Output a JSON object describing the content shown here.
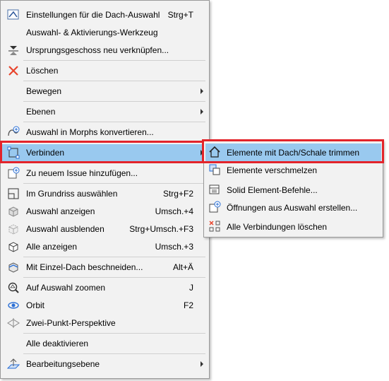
{
  "menu": {
    "items": [
      {
        "label": "Einstellungen für die Dach-Auswahl",
        "shortcut": "Strg+T",
        "icon": "roof-settings-icon"
      },
      {
        "label": "Auswahl- & Aktivierungs-Werkzeug",
        "shortcut": "",
        "icon": ""
      },
      {
        "label": "Ursprungsgeschoss neu verknüpfen...",
        "shortcut": "",
        "icon": "story-link-icon"
      },
      {
        "label": "Löschen",
        "shortcut": "",
        "icon": "delete-x-icon"
      },
      {
        "label": "Bewegen",
        "shortcut": "",
        "icon": "",
        "submenu": true
      },
      {
        "label": "Ebenen",
        "shortcut": "",
        "icon": "",
        "submenu": true
      },
      {
        "label": "Auswahl in Morphs konvertieren...",
        "shortcut": "",
        "icon": "morph-convert-icon"
      },
      {
        "label": "Verbinden",
        "shortcut": "",
        "icon": "connect-icon",
        "submenu": true
      },
      {
        "label": "Zu neuem Issue hinzufügen...",
        "shortcut": "",
        "icon": "issue-add-icon"
      },
      {
        "label": "Im Grundriss auswählen",
        "shortcut": "Strg+F2",
        "icon": "floorplan-select-icon"
      },
      {
        "label": "Auswahl anzeigen",
        "shortcut": "Umsch.+4",
        "icon": "show-selection-icon"
      },
      {
        "label": "Auswahl ausblenden",
        "shortcut": "Strg+Umsch.+F3",
        "icon": "hide-selection-icon"
      },
      {
        "label": "Alle anzeigen",
        "shortcut": "Umsch.+3",
        "icon": "show-all-icon"
      },
      {
        "label": "Mit Einzel-Dach beschneiden...",
        "shortcut": "Alt+Ä",
        "icon": "trim-roof-icon"
      },
      {
        "label": "Auf Auswahl zoomen",
        "shortcut": "J",
        "icon": "zoom-selection-icon"
      },
      {
        "label": "Orbit",
        "shortcut": "F2",
        "icon": "orbit-icon"
      },
      {
        "label": "Zwei-Punkt-Perspektive",
        "shortcut": "",
        "icon": "two-point-perspective-icon"
      },
      {
        "label": "Alle deaktivieren",
        "shortcut": "",
        "icon": ""
      },
      {
        "label": "Bearbeitungsebene",
        "shortcut": "",
        "icon": "editing-plane-icon",
        "submenu": true
      }
    ]
  },
  "submenu": {
    "items": [
      {
        "label": "Elemente mit Dach/Schale trimmen",
        "icon": "trim-with-roof-icon"
      },
      {
        "label": "Elemente verschmelzen",
        "icon": "merge-elements-icon"
      },
      {
        "label": "Solid Element-Befehle...",
        "icon": "solid-element-icon"
      },
      {
        "label": "Öffnungen aus Auswahl erstellen...",
        "icon": "create-openings-icon"
      },
      {
        "label": "Alle Verbindungen löschen",
        "icon": "delete-connections-icon"
      }
    ]
  },
  "colors": {
    "highlight": "#99c9ef",
    "callout": "#e3242b",
    "menu_bg": "#f2f2f2"
  }
}
